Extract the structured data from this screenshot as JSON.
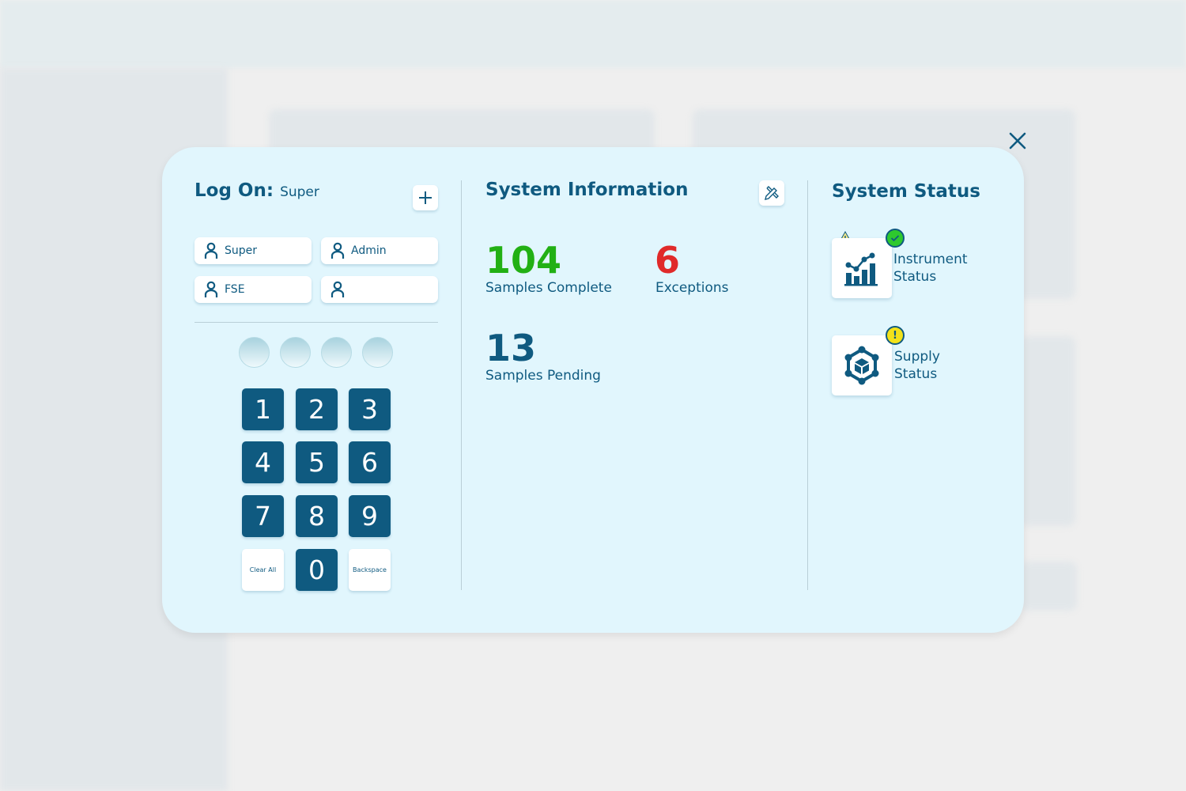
{
  "logon": {
    "title": "Log On:",
    "current_user": "Super",
    "users": [
      "Super",
      "Admin",
      "FSE",
      ""
    ],
    "pin_length": 4,
    "pin_filled": 0,
    "keypad": {
      "digits": [
        "1",
        "2",
        "3",
        "4",
        "5",
        "6",
        "7",
        "8",
        "9",
        "0"
      ],
      "clear_label": "Clear All",
      "backspace_label": "Backspace"
    }
  },
  "system_info": {
    "title": "System Information",
    "samples_complete": {
      "value": "104",
      "label": "Samples Complete",
      "color": "#22b014"
    },
    "exceptions": {
      "value": "6",
      "label": "Exceptions",
      "color": "#e02a2a"
    },
    "samples_pending": {
      "value": "13",
      "label": "Samples Pending",
      "color": "#0f5a80"
    }
  },
  "system_status": {
    "title": "System Status",
    "items": [
      {
        "label_line1": "Instrument",
        "label_line2": "Status",
        "state": "ok",
        "badge_color": "#2ec92e"
      },
      {
        "label_line1": "Supply",
        "label_line2": "Status",
        "state": "warning",
        "badge_color": "#f2e21a"
      }
    ]
  },
  "colors": {
    "primary": "#0f5a80",
    "panel": "#e1f6fd"
  }
}
